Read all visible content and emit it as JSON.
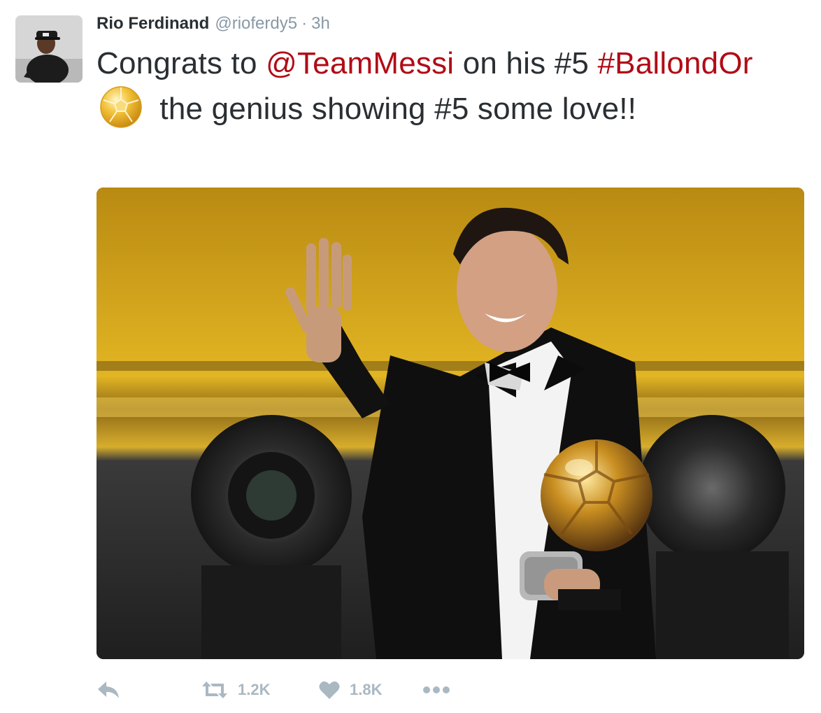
{
  "tweet": {
    "author_name": "Rio Ferdinand",
    "author_handle": "@rioferdy5",
    "separator": "·",
    "timestamp": "3h",
    "text_parts": {
      "part1": "Congrats to ",
      "mention": "@TeamMessi",
      "part2": " on his #5 ",
      "hashtag": "#BallondOr",
      "part3": " the genius showing #5 some love!!"
    },
    "link_color": "#b10b16"
  },
  "actions": {
    "reply_icon": "reply-icon",
    "retweet_icon": "retweet-icon",
    "retweet_count": "1.2K",
    "like_icon": "heart-icon",
    "like_count": "1.8K",
    "more_icon": "more-dots-icon"
  },
  "colors": {
    "action_gray": "#aab8c2",
    "meta_gray": "#8899a6",
    "text": "#292f33"
  }
}
